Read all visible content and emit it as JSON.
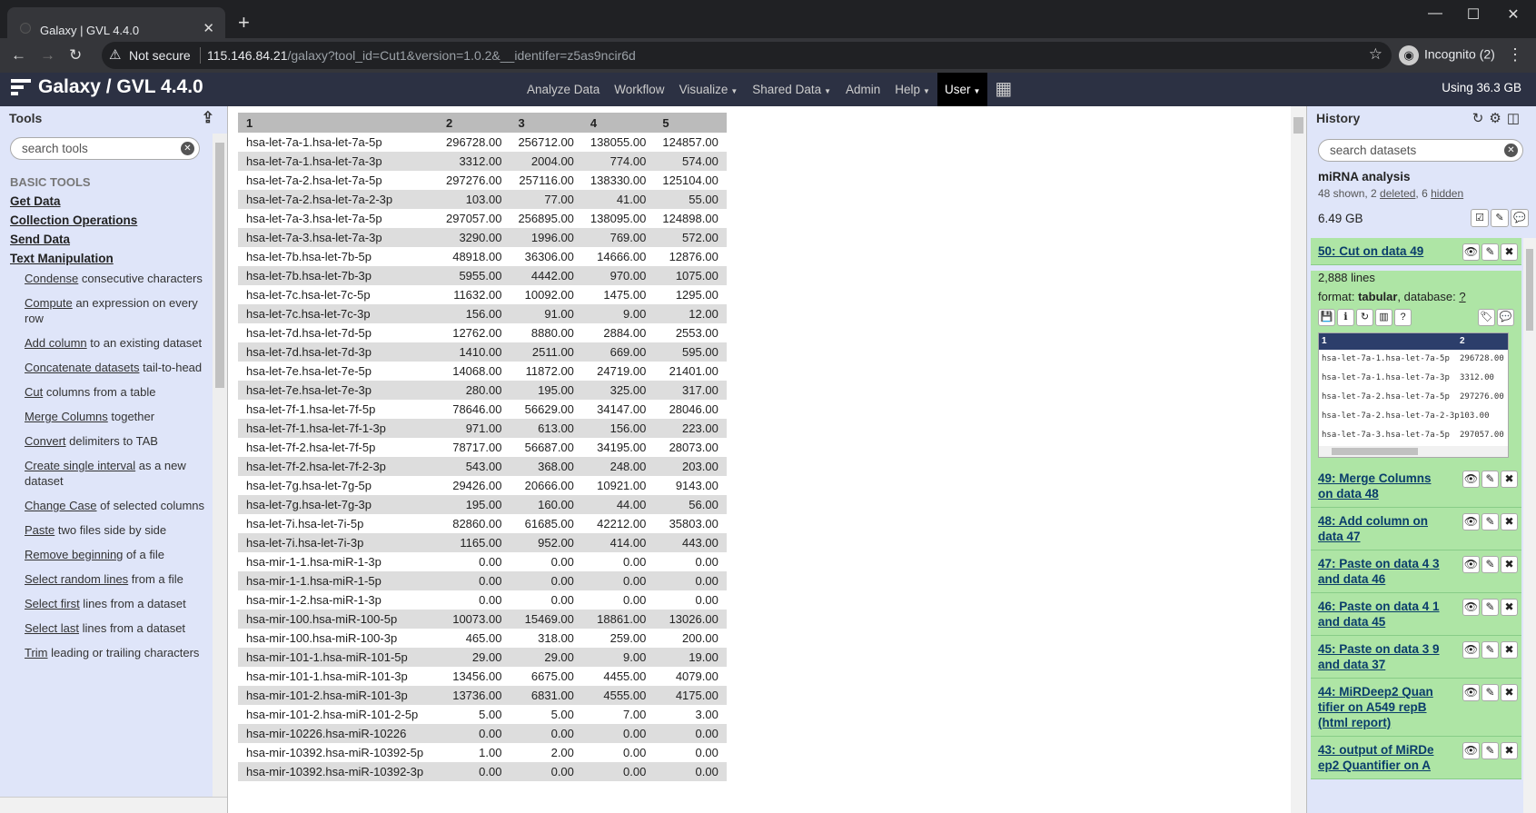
{
  "browser": {
    "tab_title": "Galaxy | GVL 4.4.0",
    "security_label": "Not secure",
    "url_host": "115.146.84.21",
    "url_path": "/galaxy?tool_id=Cut1&version=1.0.2&__identifer=z5as9ncir6d",
    "profile_label": "Incognito (2)"
  },
  "masthead": {
    "brand": "Galaxy / GVL 4.4.0",
    "nav": [
      "Analyze Data",
      "Workflow",
      "Visualize",
      "Shared Data",
      "Admin",
      "Help",
      "User"
    ],
    "quota": "Using 36.3 GB"
  },
  "tools_panel": {
    "title": "Tools",
    "search_placeholder": "search tools",
    "section_header": "BASIC TOOLS",
    "categories": [
      "Get Data",
      "Collection Operations",
      "Send Data",
      "Text Manipulation"
    ],
    "tools": [
      {
        "link": "Condense",
        "desc": " consecutive characters"
      },
      {
        "link": "Compute",
        "desc": " an expression on every row"
      },
      {
        "link": "Add column",
        "desc": " to an existing dataset"
      },
      {
        "link": "Concatenate datasets",
        "desc": " tail-to-head"
      },
      {
        "link": "Cut",
        "desc": " columns from a table"
      },
      {
        "link": "Merge Columns",
        "desc": " together"
      },
      {
        "link": "Convert",
        "desc": " delimiters to TAB"
      },
      {
        "link": "Create single interval",
        "desc": " as a new dataset"
      },
      {
        "link": "Change Case",
        "desc": " of selected columns"
      },
      {
        "link": "Paste",
        "desc": " two files side by side"
      },
      {
        "link": "Remove beginning",
        "desc": " of a file"
      },
      {
        "link": "Select random lines",
        "desc": " from a file"
      },
      {
        "link": "Select first",
        "desc": " lines from a dataset"
      },
      {
        "link": "Select last",
        "desc": " lines from a dataset"
      },
      {
        "link": "Trim",
        "desc": " leading or trailing characters"
      }
    ]
  },
  "table": {
    "headers": [
      "1",
      "2",
      "3",
      "4",
      "5"
    ],
    "rows": [
      [
        "hsa-let-7a-1.hsa-let-7a-5p",
        "296728.00",
        "256712.00",
        "138055.00",
        "124857.00"
      ],
      [
        "hsa-let-7a-1.hsa-let-7a-3p",
        "3312.00",
        "2004.00",
        "774.00",
        "574.00"
      ],
      [
        "hsa-let-7a-2.hsa-let-7a-5p",
        "297276.00",
        "257116.00",
        "138330.00",
        "125104.00"
      ],
      [
        "hsa-let-7a-2.hsa-let-7a-2-3p",
        "103.00",
        "77.00",
        "41.00",
        "55.00"
      ],
      [
        "hsa-let-7a-3.hsa-let-7a-5p",
        "297057.00",
        "256895.00",
        "138095.00",
        "124898.00"
      ],
      [
        "hsa-let-7a-3.hsa-let-7a-3p",
        "3290.00",
        "1996.00",
        "769.00",
        "572.00"
      ],
      [
        "hsa-let-7b.hsa-let-7b-5p",
        "48918.00",
        "36306.00",
        "14666.00",
        "12876.00"
      ],
      [
        "hsa-let-7b.hsa-let-7b-3p",
        "5955.00",
        "4442.00",
        "970.00",
        "1075.00"
      ],
      [
        "hsa-let-7c.hsa-let-7c-5p",
        "11632.00",
        "10092.00",
        "1475.00",
        "1295.00"
      ],
      [
        "hsa-let-7c.hsa-let-7c-3p",
        "156.00",
        "91.00",
        "9.00",
        "12.00"
      ],
      [
        "hsa-let-7d.hsa-let-7d-5p",
        "12762.00",
        "8880.00",
        "2884.00",
        "2553.00"
      ],
      [
        "hsa-let-7d.hsa-let-7d-3p",
        "1410.00",
        "2511.00",
        "669.00",
        "595.00"
      ],
      [
        "hsa-let-7e.hsa-let-7e-5p",
        "14068.00",
        "11872.00",
        "24719.00",
        "21401.00"
      ],
      [
        "hsa-let-7e.hsa-let-7e-3p",
        "280.00",
        "195.00",
        "325.00",
        "317.00"
      ],
      [
        "hsa-let-7f-1.hsa-let-7f-5p",
        "78646.00",
        "56629.00",
        "34147.00",
        "28046.00"
      ],
      [
        "hsa-let-7f-1.hsa-let-7f-1-3p",
        "971.00",
        "613.00",
        "156.00",
        "223.00"
      ],
      [
        "hsa-let-7f-2.hsa-let-7f-5p",
        "78717.00",
        "56687.00",
        "34195.00",
        "28073.00"
      ],
      [
        "hsa-let-7f-2.hsa-let-7f-2-3p",
        "543.00",
        "368.00",
        "248.00",
        "203.00"
      ],
      [
        "hsa-let-7g.hsa-let-7g-5p",
        "29426.00",
        "20666.00",
        "10921.00",
        "9143.00"
      ],
      [
        "hsa-let-7g.hsa-let-7g-3p",
        "195.00",
        "160.00",
        "44.00",
        "56.00"
      ],
      [
        "hsa-let-7i.hsa-let-7i-5p",
        "82860.00",
        "61685.00",
        "42212.00",
        "35803.00"
      ],
      [
        "hsa-let-7i.hsa-let-7i-3p",
        "1165.00",
        "952.00",
        "414.00",
        "443.00"
      ],
      [
        "hsa-mir-1-1.hsa-miR-1-3p",
        "0.00",
        "0.00",
        "0.00",
        "0.00"
      ],
      [
        "hsa-mir-1-1.hsa-miR-1-5p",
        "0.00",
        "0.00",
        "0.00",
        "0.00"
      ],
      [
        "hsa-mir-1-2.hsa-miR-1-3p",
        "0.00",
        "0.00",
        "0.00",
        "0.00"
      ],
      [
        "hsa-mir-100.hsa-miR-100-5p",
        "10073.00",
        "15469.00",
        "18861.00",
        "13026.00"
      ],
      [
        "hsa-mir-100.hsa-miR-100-3p",
        "465.00",
        "318.00",
        "259.00",
        "200.00"
      ],
      [
        "hsa-mir-101-1.hsa-miR-101-5p",
        "29.00",
        "29.00",
        "9.00",
        "19.00"
      ],
      [
        "hsa-mir-101-1.hsa-miR-101-3p",
        "13456.00",
        "6675.00",
        "4455.00",
        "4079.00"
      ],
      [
        "hsa-mir-101-2.hsa-miR-101-3p",
        "13736.00",
        "6831.00",
        "4555.00",
        "4175.00"
      ],
      [
        "hsa-mir-101-2.hsa-miR-101-2-5p",
        "5.00",
        "5.00",
        "7.00",
        "3.00"
      ],
      [
        "hsa-mir-10226.hsa-miR-10226",
        "0.00",
        "0.00",
        "0.00",
        "0.00"
      ],
      [
        "hsa-mir-10392.hsa-miR-10392-5p",
        "1.00",
        "2.00",
        "0.00",
        "0.00"
      ],
      [
        "hsa-mir-10392.hsa-miR-10392-3p",
        "0.00",
        "0.00",
        "0.00",
        "0.00"
      ]
    ]
  },
  "history": {
    "title": "History",
    "search_placeholder": "search datasets",
    "name": "miRNA analysis",
    "shown": "48 shown, 2 ",
    "deleted": "deleted",
    "comma": ", 6 ",
    "hidden": "hidden",
    "size": "6.49 GB",
    "expanded": {
      "title": "50: Cut on data 49",
      "lines": "2,888 lines",
      "format_label": "format: ",
      "format": "tabular",
      "db_label": ", database: ",
      "db": "?",
      "peek_headers": [
        "1",
        "2"
      ],
      "peek_rows": [
        [
          "hsa-let-7a-1.hsa-let-7a-5p",
          "296728.00"
        ],
        [
          "hsa-let-7a-1.hsa-let-7a-3p",
          "3312.00"
        ],
        [
          "hsa-let-7a-2.hsa-let-7a-5p",
          "297276.00"
        ],
        [
          "hsa-let-7a-2.hsa-let-7a-2-3p",
          "103.00"
        ],
        [
          "hsa-let-7a-3.hsa-let-7a-5p",
          "297057.00"
        ]
      ]
    },
    "datasets": [
      "49: Merge Columns on data 48",
      "48: Add column on data 47",
      "47: Paste on data 4 3 and data 46",
      "46: Paste on data 4 1 and data 45",
      "45: Paste on data 3 9 and data 37",
      "44: MiRDeep2 Quan tifier on A549 repB (html report)",
      "43: output of MiRDe ep2 Quantifier on A"
    ]
  }
}
